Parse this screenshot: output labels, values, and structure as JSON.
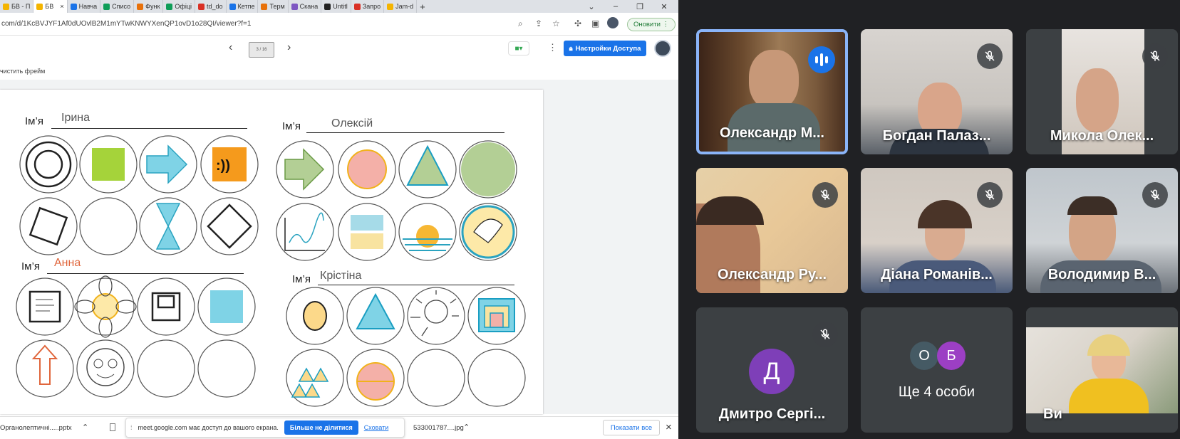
{
  "browser": {
    "tabs": [
      {
        "label": "БВ - П",
        "color": "#f4b400"
      },
      {
        "label": "БВ",
        "color": "#f4b400",
        "active": true
      },
      {
        "label": "Навча",
        "color": "#1a73e8"
      },
      {
        "label": "Списо",
        "color": "#0f9d58"
      },
      {
        "label": "Функ",
        "color": "#e8710a"
      },
      {
        "label": "Офіці",
        "color": "#0f9d58"
      },
      {
        "label": "td_do",
        "color": "#d93025"
      },
      {
        "label": "Кетпе",
        "color": "#1a73e8"
      },
      {
        "label": "Терм",
        "color": "#e8710a"
      },
      {
        "label": "Скана",
        "color": "#7e57c2"
      },
      {
        "label": "Untitl",
        "color": "#222222"
      },
      {
        "label": "Запро",
        "color": "#d93025"
      },
      {
        "label": "Jam-d",
        "color": "#f4b400"
      }
    ],
    "close_tab": "×",
    "new_tab": "+",
    "url": "com/d/1KcBVJYF1Af0dUOvlB2M1mYTwKNWYXenQP1ovD1o28QI/viewer?f=1",
    "update_label": "Оновити"
  },
  "jam": {
    "prev": "‹",
    "next": "›",
    "frame_label": "3 / 16",
    "access_label": "Настройки Доступа",
    "clear_frame": "чистить фрейм"
  },
  "whiteboard": {
    "name_prefix": "Ім’я",
    "names": [
      "Ірина",
      "Олексій",
      "Анна",
      "Крістіна"
    ],
    "name_colors": [
      "#555555",
      "#555555",
      "#e0663c",
      "#555555"
    ]
  },
  "downloads": {
    "file1": "Органолептичні.....pptx",
    "file2": "533001787....jpg",
    "share_text": "meet.google.com має доступ до вашого екрана.",
    "stop_share": "Більше не ділитися",
    "hide": "Сховати",
    "show_all": "Показати все",
    "close": "×"
  },
  "meet": {
    "participants": [
      {
        "name": "Олександр М...",
        "state": "speaking"
      },
      {
        "name": "Богдан Палаз...",
        "state": "muted"
      },
      {
        "name": "Микола Олек...",
        "state": "muted"
      },
      {
        "name": "Олександр Ру...",
        "state": "muted"
      },
      {
        "name": "Діана Романів...",
        "state": "muted"
      },
      {
        "name": "Володимир В...",
        "state": "muted"
      },
      {
        "name": "Дмитро Сергі...",
        "state": "muted",
        "initial": "Д"
      },
      {
        "name": "Ще 4 особи",
        "initials": [
          "О",
          "Б"
        ]
      },
      {
        "name": "Ви"
      }
    ]
  }
}
